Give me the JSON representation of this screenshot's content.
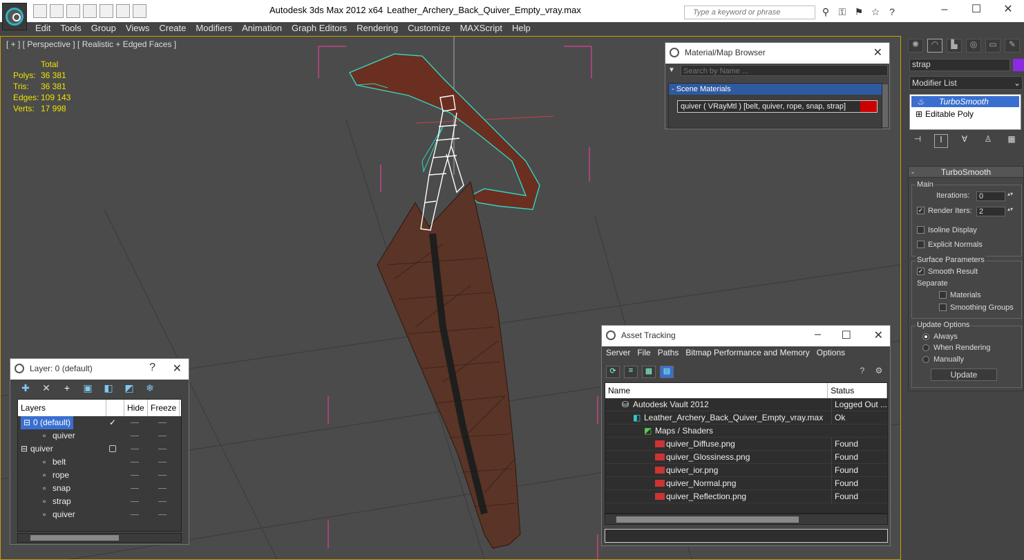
{
  "app": {
    "title": "Autodesk 3ds Max  2012 x64",
    "file": "Leather_Archery_Back_Quiver_Empty_vray.max"
  },
  "search": {
    "placeholder": "Type a keyword or phrase"
  },
  "menu": [
    "Edit",
    "Tools",
    "Group",
    "Views",
    "Create",
    "Modifiers",
    "Animation",
    "Graph Editors",
    "Rendering",
    "Customize",
    "MAXScript",
    "Help"
  ],
  "viewport": {
    "label": "[ + ] [ Perspective ] [ Realistic + Edged Faces ]",
    "stats_header": "Total",
    "stats": [
      {
        "k": "Polys:",
        "v": "36 381"
      },
      {
        "k": "Tris:",
        "v": "36 381"
      },
      {
        "k": "Edges:",
        "v": "109 143"
      },
      {
        "k": "Verts:",
        "v": "17 998"
      }
    ]
  },
  "material_browser": {
    "title": "Material/Map Browser",
    "search_placeholder": "Search by Name ...",
    "group": "- Scene Materials",
    "entry": "quiver  ( VRayMtl )  [belt, quiver, rope, snap, strap]"
  },
  "layer_panel": {
    "title": "Layer: 0 (default)",
    "help": "?",
    "cols": {
      "layers": "Layers",
      "hide": "Hide",
      "freeze": "Freeze"
    },
    "rows": [
      {
        "name": "0 (default)",
        "level": 0,
        "selected": true,
        "current": true
      },
      {
        "name": "quiver",
        "level": 1
      },
      {
        "name": "quiver",
        "level": 0,
        "box": true
      },
      {
        "name": "belt",
        "level": 1
      },
      {
        "name": "rope",
        "level": 1
      },
      {
        "name": "snap",
        "level": 1
      },
      {
        "name": "strap",
        "level": 1
      },
      {
        "name": "quiver",
        "level": 1
      }
    ]
  },
  "asset_tracking": {
    "title": "Asset Tracking",
    "menu": [
      "Server",
      "File",
      "Paths",
      "Bitmap Performance and Memory",
      "Options"
    ],
    "cols": {
      "name": "Name",
      "status": "Status"
    },
    "rows": [
      {
        "name": "Autodesk Vault 2012",
        "status": "Logged Out ...",
        "indent": 1,
        "icon": "vault"
      },
      {
        "name": "Leather_Archery_Back_Quiver_Empty_vray.max",
        "status": "Ok",
        "indent": 2,
        "icon": "max"
      },
      {
        "name": "Maps / Shaders",
        "status": "",
        "indent": 3,
        "icon": "folder"
      },
      {
        "name": "quiver_Diffuse.png",
        "status": "Found",
        "indent": 4,
        "icon": "png"
      },
      {
        "name": "quiver_Glossiness.png",
        "status": "Found",
        "indent": 4,
        "icon": "png"
      },
      {
        "name": "quiver_ior.png",
        "status": "Found",
        "indent": 4,
        "icon": "png"
      },
      {
        "name": "quiver_Normal.png",
        "status": "Found",
        "indent": 4,
        "icon": "png"
      },
      {
        "name": "quiver_Reflection.png",
        "status": "Found",
        "indent": 4,
        "icon": "png"
      }
    ]
  },
  "command_panel": {
    "object_name": "strap",
    "object_color": "#8a2be2",
    "modifier_list": "Modifier List",
    "stack": [
      "TurboSmooth",
      "Editable Poly"
    ],
    "rollout": "TurboSmooth",
    "main": "Main",
    "iterations_label": "Iterations:",
    "iterations": "0",
    "render_iters_label": "Render Iters:",
    "render_iters": "2",
    "isoline": "Isoline Display",
    "explicit": "Explicit Normals",
    "surface": "Surface Parameters",
    "smooth_result": "Smooth Result",
    "separate": "Separate",
    "materials": "Materials",
    "smoothing_groups": "Smoothing Groups",
    "update_options": "Update Options",
    "always": "Always",
    "when_rendering": "When Rendering",
    "manually": "Manually",
    "update": "Update"
  }
}
